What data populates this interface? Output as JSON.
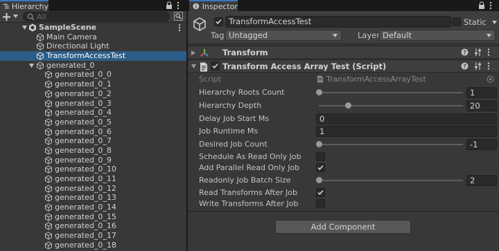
{
  "hierarchy": {
    "tab_label": "Hierarchy",
    "search_placeholder": "All",
    "scene_name": "SampleScene",
    "items": [
      {
        "label": "Main Camera"
      },
      {
        "label": "Directional Light"
      },
      {
        "label": "TransformAccessTest",
        "selected": true
      },
      {
        "label": "generated_0"
      }
    ],
    "children": [
      "generated_0_0",
      "generated_0_1",
      "generated_0_2",
      "generated_0_3",
      "generated_0_4",
      "generated_0_5",
      "generated_0_6",
      "generated_0_7",
      "generated_0_8",
      "generated_0_9",
      "generated_0_10",
      "generated_0_11",
      "generated_0_12",
      "generated_0_13",
      "generated_0_14",
      "generated_0_15",
      "generated_0_16",
      "generated_0_17",
      "generated_0_18"
    ]
  },
  "inspector": {
    "tab_label": "Inspector",
    "object_name": "TransformAccessTest",
    "active": true,
    "static_label": "Static",
    "static": false,
    "tag_label": "Tag",
    "tag_value": "Untagged",
    "layer_label": "Layer",
    "layer_value": "Default",
    "transform_title": "Transform",
    "component_title": "Transform Access Array Test (Script)",
    "component_enabled": true,
    "script_label": "Script",
    "script_value": "TransformAccessArrayTest",
    "add_component_label": "Add Component",
    "props": {
      "hierarchy_roots_count": {
        "label": "Hierarchy Roots Count",
        "value": "1",
        "slider_fraction": 0.0
      },
      "hierarchy_depth": {
        "label": "Hierarchy Depth",
        "value": "20",
        "slider_fraction": 0.2
      },
      "delay_job_start_ms": {
        "label": "Delay Job Start Ms",
        "value": "0"
      },
      "job_runtime_ms": {
        "label": "Job Runtime Ms",
        "value": "1"
      },
      "desired_job_count": {
        "label": "Desired Job Count",
        "value": "-1",
        "slider_fraction": 0.0
      },
      "schedule_as_read_only_job": {
        "label": "Schedule As Read Only Job",
        "checked": false
      },
      "add_parallel_read_only_job": {
        "label": "Add Parallel Read Only Job",
        "checked": true
      },
      "readonly_job_batch_size": {
        "label": "Readonly Job Batch Size",
        "value": "2",
        "slider_fraction": 0.0
      },
      "read_transforms_after_job": {
        "label": "Read Transforms After Job",
        "checked": true
      },
      "write_transforms_after_job": {
        "label": "Write Transforms After Job",
        "checked": false
      }
    }
  },
  "colors": {
    "panel_bg": "#383838",
    "header_bg": "#3e3e3e",
    "selection": "#2c5d87",
    "field_bg": "#2a2a2a",
    "tab_accent": "#3a79bb",
    "text": "#c4c4c4",
    "transform_icon_red": "#e5533f",
    "transform_icon_green": "#7dc242",
    "transform_icon_blue": "#4a8be0"
  },
  "icons": {
    "hierarchy_tab": "hierarchy-icon",
    "inspector_tab": "info-icon",
    "lock": "lock-icon",
    "menu": "kebab-menu-icon",
    "scene": "unity-scene-icon",
    "gameobject": "cube-icon",
    "transform": "transform-axes-icon",
    "script": "script-icon",
    "help": "help-icon",
    "presets": "presets-icon"
  }
}
